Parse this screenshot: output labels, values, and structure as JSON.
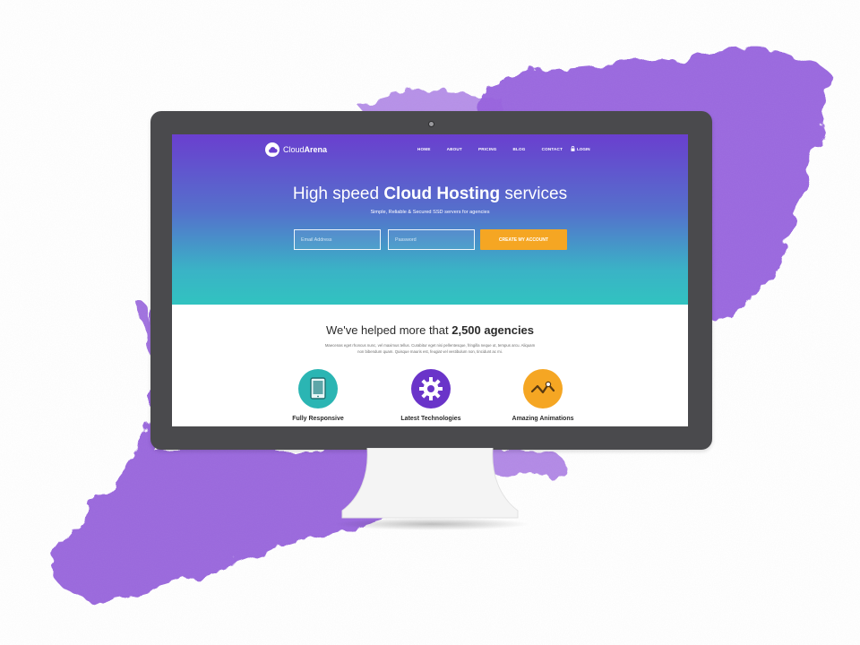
{
  "brand": {
    "name_light": "Cloud",
    "name_bold": "Arena",
    "icon": "cloud-icon"
  },
  "nav": {
    "items": [
      {
        "label": "HOME"
      },
      {
        "label": "ABOUT"
      },
      {
        "label": "PRICING"
      },
      {
        "label": "BLOG"
      },
      {
        "label": "CONTACT"
      }
    ],
    "login_label": "LOGIN",
    "login_icon": "lock-icon"
  },
  "hero": {
    "title_pre": "High speed ",
    "title_bold": "Cloud Hosting",
    "title_post": " services",
    "subtitle": "Simple, Reliable & Secured SSD servers for agencies",
    "email_placeholder": "Email Address",
    "password_placeholder": "Password",
    "cta_label": "CREATE MY ACCOUNT",
    "gradient_top": "#6a3fcf",
    "gradient_bottom": "#31c3c0",
    "cta_color": "#f5a623"
  },
  "agencies": {
    "title_pre": "We've helped more that ",
    "title_bold": "2,500 agencies",
    "body": "Maecenas eget rhoncus nunc, vel maximus tellus. Curabitur eget nisi pellentesque, fringilla neque ut, tempus arcu. Aliquam non bibendum quam. Quisque mauris est, feugiat vel vestibulum non, tincidunt ac mi."
  },
  "features": [
    {
      "label": "Fully Responsive",
      "icon": "tablet-icon",
      "color": "#2bb5b3"
    },
    {
      "label": "Latest Technologies",
      "icon": "gear-icon",
      "color": "#6a34c9"
    },
    {
      "label": "Amazing Animations",
      "icon": "chart-line-icon",
      "color": "#f5a623"
    }
  ],
  "decor": {
    "splash_color": "#8a4fd8",
    "monitor_color": "#4a4a4d"
  }
}
